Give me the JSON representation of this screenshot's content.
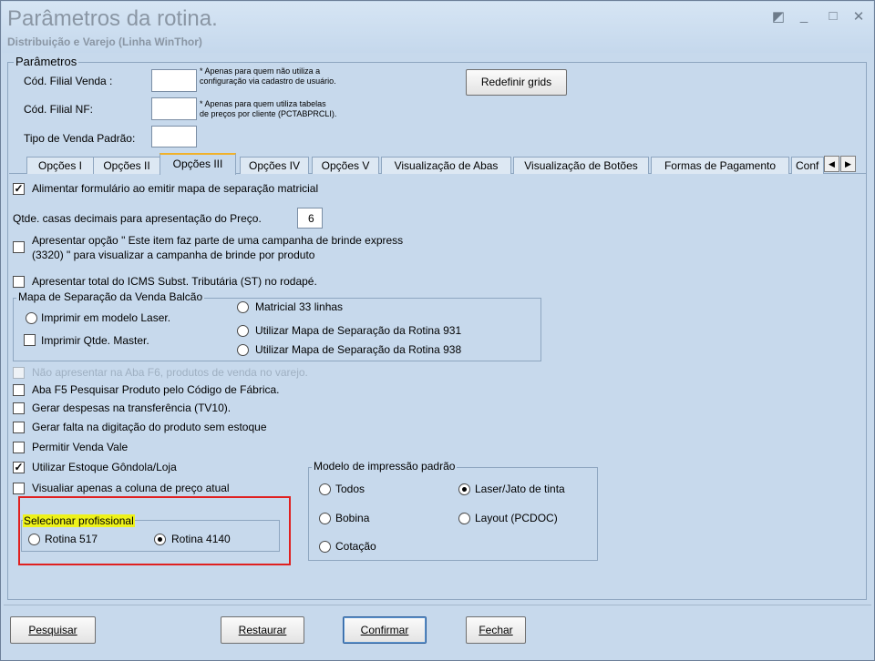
{
  "window": {
    "title": "Parâmetros da rotina.",
    "subtitle": "Distribuição e Varejo (Linha WinThor)"
  },
  "winctl": {
    "pin": "◩",
    "min": "_",
    "max": "□",
    "close": "✕"
  },
  "params": {
    "group": "Parâmetros",
    "filial_venda": {
      "label": "Cód. Filial Venda :",
      "value": "",
      "note": "* Apenas para quem não utiliza a\nconfiguração via cadastro de usuário."
    },
    "filial_nf": {
      "label": "Cód. Filial NF:",
      "value": "",
      "note": "* Apenas para quem utiliza tabelas\nde preços por cliente (PCTABPRCLI)."
    },
    "tipo_venda": {
      "label": "Tipo de Venda Padrão:",
      "value": ""
    },
    "redefinir": "Redefinir grids"
  },
  "tabs": [
    "Opções I",
    "Opções II",
    "Opções III",
    "Opções IV",
    "Opções V",
    "Visualização de Abas",
    "Visualização de Botões",
    "Formas de Pagamento",
    "Conf"
  ],
  "options": {
    "alimentar": "Alimentar formulário ao emitir mapa de separação matricial",
    "qtde_casas_label": "Qtde. casas decimais para apresentação do Preço.",
    "qtde_casas_value": "6",
    "campanha_l1": "Apresentar opção \" Este item faz parte de uma campanha de brinde express",
    "campanha_l2": "(3320) \" para visualizar a campanha de brinde por produto",
    "icms_st": "Apresentar total do ICMS Subst. Tributária (ST) no rodapé.",
    "mapa_group": "Mapa de Separação da Venda Balcão",
    "laser": "Imprimir em modelo Laser.",
    "qtde_master": "Imprimir Qtde. Master.",
    "matricial33": "Matricial 33 linhas",
    "rotina931": "Utilizar Mapa de Separação da Rotina 931",
    "rotina938": "Utilizar Mapa de Separação  da Rotina 938",
    "nao_aba_f6": "Não apresentar na Aba F6, produtos de venda no varejo.",
    "aba_f5": "Aba F5 Pesquisar Produto pelo Código de Fábrica.",
    "despesas": "Gerar despesas na transferência (TV10).",
    "falta": "Gerar falta na digitação do produto sem estoque",
    "venda_vale": "Permitir Venda Vale",
    "estoque_gondola": "Utilizar Estoque Gôndola/Loja",
    "coluna_preco": "Visualiar apenas a coluna de preço atual",
    "prof_group": "Selecionar profissional",
    "rot517": "Rotina 517",
    "rot4140": "Rotina 4140",
    "modelo_group": "Modelo de impressão padrão",
    "todos": "Todos",
    "laser_jato": "Laser/Jato de tinta",
    "bobina": "Bobina",
    "layout": "Layout (PCDOC)",
    "cotacao": "Cotação"
  },
  "checked": {
    "alimentar": true,
    "estoque_gondola": true,
    "rot4140": true,
    "laser_jato": true
  },
  "buttons": {
    "pesquisar": "Pesquisar",
    "restaurar": "Restaurar",
    "confirmar": "Confirmar",
    "fechar": "Fechar"
  },
  "colors": {
    "highlight": "#eef21a",
    "red_box": "#e02020",
    "active_tab": "#f0b12b"
  }
}
